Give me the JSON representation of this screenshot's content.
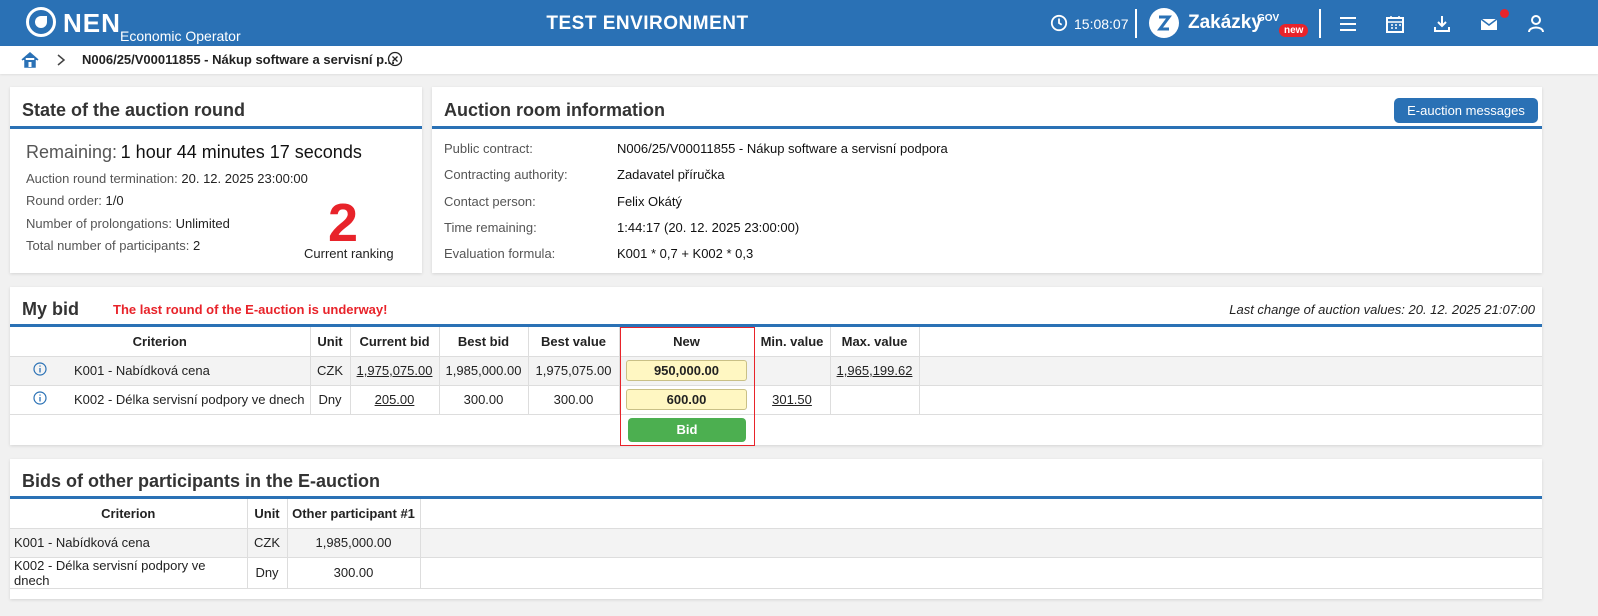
{
  "header": {
    "logo": "NEN",
    "logo_sub": "Economic Operator",
    "environment": "TEST ENVIRONMENT",
    "time": "15:08:07",
    "brand": "Zakázky",
    "brand_sup": "GOV",
    "brand_badge": "new",
    "icons": [
      "menu-icon",
      "calendar-icon",
      "download-icon",
      "mail-icon",
      "user-icon"
    ]
  },
  "breadcrumb": {
    "title": "N006/25/V00011855 - Nákup software a servisní p..."
  },
  "state": {
    "title": "State of the auction round",
    "remaining_label": "Remaining:",
    "remaining_value": "1 hour 44 minutes 17 seconds",
    "termination_label": "Auction round termination:",
    "termination_value": "20. 12. 2025 23:00:00",
    "round_label": "Round order:",
    "round_value": "1/0",
    "prolong_label": "Number of prolongations:",
    "prolong_value": "Unlimited",
    "participants_label": "Total number of participants:",
    "participants_value": "2",
    "ranking": "2",
    "ranking_label": "Current ranking"
  },
  "room": {
    "title": "Auction room information",
    "messages_button": "E-auction messages",
    "rows": [
      {
        "label": "Public contract:",
        "value": "N006/25/V00011855 - Nákup software a servisní podpora"
      },
      {
        "label": "Contracting authority:",
        "value": "Zadavatel příručka"
      },
      {
        "label": "Contact person:",
        "value": "Felix Okátý"
      },
      {
        "label": "Time remaining:",
        "value": "1:44:17 (20. 12. 2025 23:00:00)"
      },
      {
        "label": "Evaluation formula:",
        "value": "K001 * 0,7 + K002 * 0,3"
      }
    ]
  },
  "mybid": {
    "title": "My bid",
    "warning": "The last round of the E-auction is underway!",
    "last_change_label": "Last change of auction values:",
    "last_change_value": "20. 12. 2025 21:07:00",
    "headers": [
      "Criterion",
      "Unit",
      "Current bid",
      "Best bid",
      "Best value",
      "New",
      "Min. value",
      "Max. value"
    ],
    "rows": [
      {
        "criterion": "K001 - Nabídková cena",
        "unit": "CZK",
        "current": "1,975,075.00",
        "best_bid": "1,985,000.00",
        "best_value": "1,975,075.00",
        "new": "950,000.00",
        "min": "",
        "max": "1,965,199.62"
      },
      {
        "criterion": "K002 - Délka servisní podpory ve dnech",
        "unit": "Dny",
        "current": "205.00",
        "best_bid": "300.00",
        "best_value": "300.00",
        "new": "600.00",
        "min": "301.50",
        "max": ""
      }
    ],
    "bid_button": "Bid"
  },
  "others": {
    "title": "Bids of other participants in the E-auction",
    "headers": [
      "Criterion",
      "Unit",
      "Other participant #1"
    ],
    "rows": [
      {
        "criterion": "K001 - Nabídková cena",
        "unit": "CZK",
        "p1": "1,985,000.00"
      },
      {
        "criterion": "K002 - Délka servisní podpory ve dnech",
        "unit": "Dny",
        "p1": "300.00"
      }
    ]
  },
  "colors": {
    "primary": "#2a71b5",
    "alert": "#e8232a",
    "bid": "#4caf50",
    "input": "#fff7c2"
  }
}
